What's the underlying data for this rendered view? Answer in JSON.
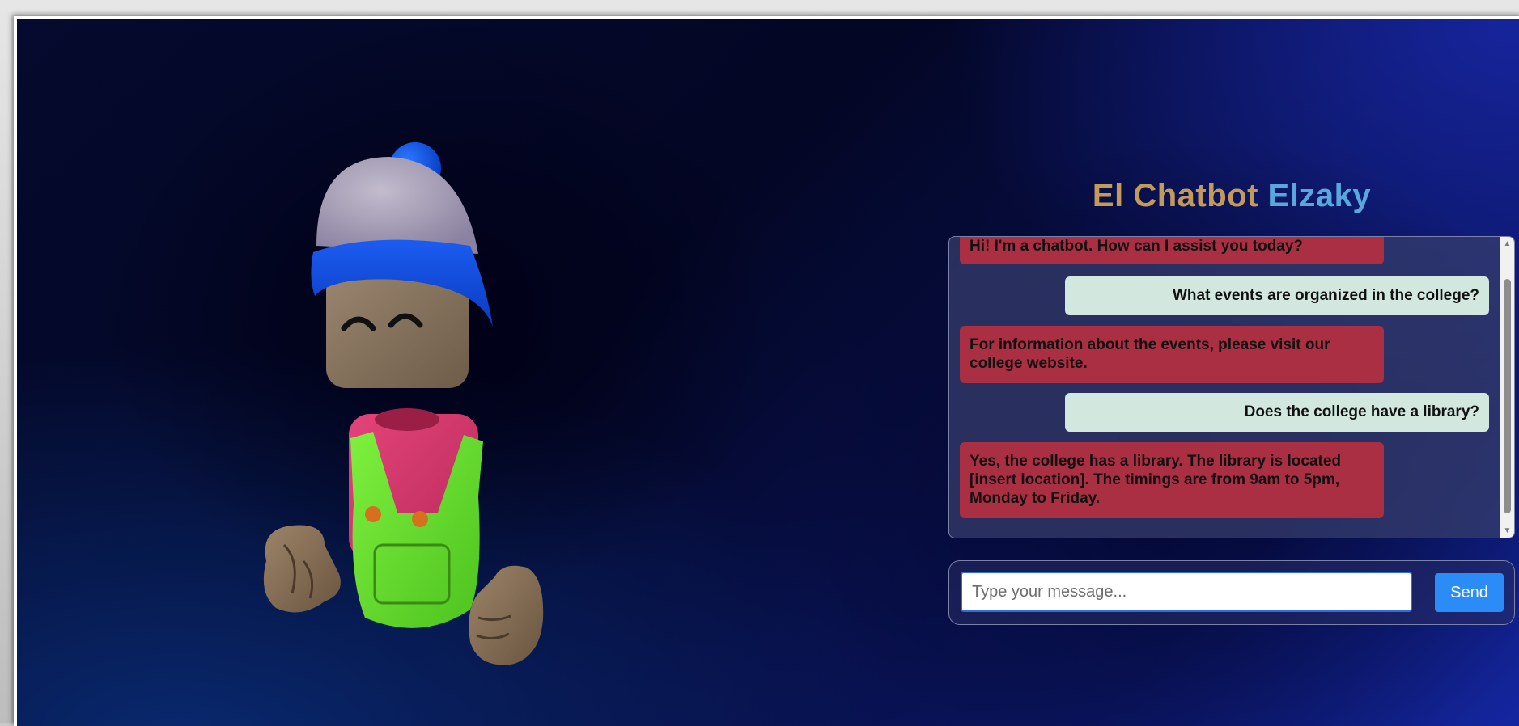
{
  "header": {
    "title_part_1": "El Chatbot",
    "title_part_2": "Elzaky"
  },
  "chat": {
    "messages": [
      {
        "sender": "bot",
        "text": "Hi! I'm a chatbot. How can I assist you today?"
      },
      {
        "sender": "user",
        "text": "What events are organized in the college?"
      },
      {
        "sender": "bot",
        "text": "For information about the events, please visit our college website."
      },
      {
        "sender": "user",
        "text": "Does the college have a library?"
      },
      {
        "sender": "bot",
        "text": "Yes, the college has a library. The library is located [insert location]. The timings are from 9am to 5pm, Monday to Friday."
      }
    ]
  },
  "input": {
    "placeholder": "Type your message...",
    "value": ""
  },
  "send_button": {
    "label": "Send"
  },
  "colors": {
    "title_part_1": "#c49a5a",
    "title_part_2": "#58a8de",
    "bot_bubble": "#ab2f42",
    "user_bubble": "#d2e8df",
    "send_button": "#2b8cf7"
  },
  "icons": {
    "scroll_up": "triangle-up-icon",
    "scroll_down": "triangle-down-icon",
    "mascot": "3d-robot-mascot"
  }
}
